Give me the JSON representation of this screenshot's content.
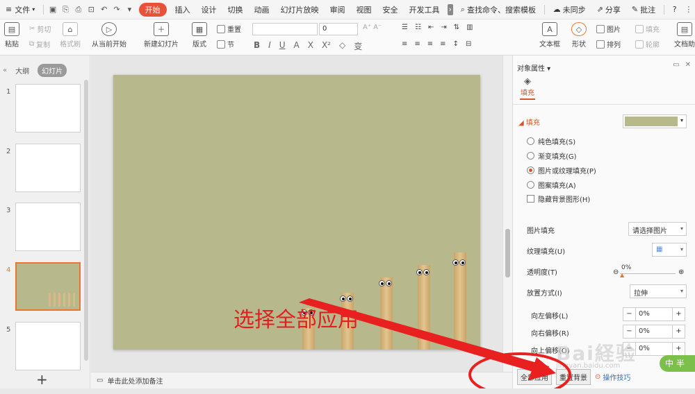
{
  "menubar": {
    "file": "文件",
    "tabs": [
      "开始",
      "插入",
      "设计",
      "切换",
      "动画",
      "幻灯片放映",
      "审阅",
      "视图",
      "安全",
      "开发工具"
    ],
    "active_tab": "开始",
    "search": "查找命令、搜索模板",
    "sync": "未同步",
    "share": "分享",
    "comment": "批注",
    "help": "?"
  },
  "ribbon": {
    "paste": "粘贴",
    "cut": "剪切",
    "copy": "复制",
    "format_painter": "格式刷",
    "from_current": "从当前开始",
    "new_slide": "新建幻灯片",
    "layout": "版式",
    "section": "节",
    "reset": "重置",
    "font_size": "0",
    "textbox": "文本框",
    "shape": "形状",
    "picture": "图片",
    "arrange": "排列",
    "fill": "填充",
    "outline": "轮廓",
    "doc_assistant": "文档助"
  },
  "leftpane": {
    "tab_outline": "大纲",
    "tab_slides": "幻灯片",
    "slides": [
      "1",
      "2",
      "3",
      "4",
      "5"
    ],
    "selected": "4",
    "add": "+"
  },
  "slide": {
    "annotation": "选择全部应用"
  },
  "notes": {
    "placeholder": "单击此处添加备注"
  },
  "panel": {
    "title": "对象属性",
    "fill_tab": "填充",
    "fill_section": "填充",
    "options": [
      "纯色填充(S)",
      "渐变填充(G)",
      "图片或纹理填充(P)",
      "图案填充(A)"
    ],
    "selected_option": "图片或纹理填充(P)",
    "hide_bg": "隐藏背景图形(H)",
    "picture_fill_label": "图片填充",
    "picture_fill_value": "请选择图片",
    "texture_fill_label": "纹理填充(U)",
    "transparency_label": "透明度(T)",
    "transparency_value": "0%",
    "placement_label": "放置方式(I)",
    "placement_value": "拉伸",
    "offset_left_label": "向左偏移(L)",
    "offset_left_value": "0%",
    "offset_right_label": "向右偏移(R)",
    "offset_right_value": "0%",
    "offset_up_label": "向上偏移(O)",
    "offset_up_value": "0%",
    "apply_all": "全部应用",
    "reset_bg": "重置背景",
    "tips": "操作技巧"
  },
  "overlay": {
    "badge": "中 半"
  },
  "colors": {
    "accent": "#e8523a",
    "slide_bg": "#b7b98c",
    "annotation": "#e02020"
  }
}
